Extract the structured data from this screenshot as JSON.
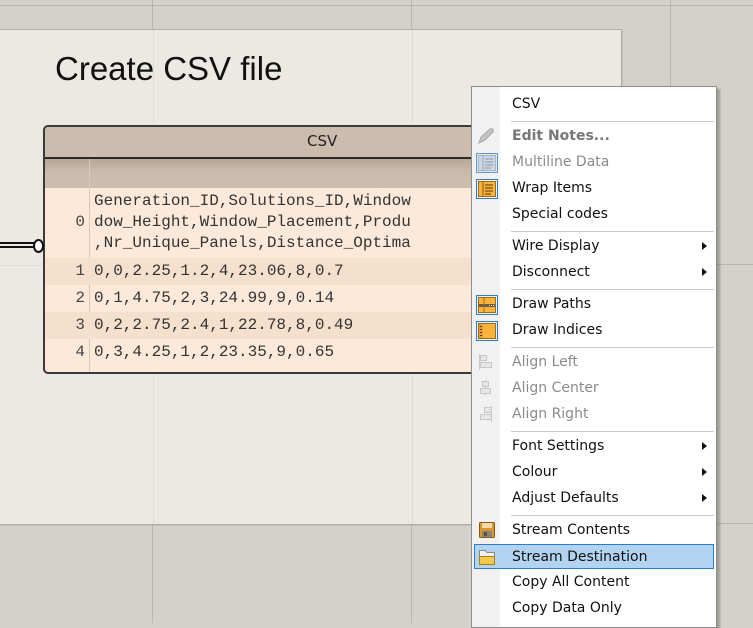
{
  "group": {
    "title": "Create CSV file"
  },
  "panel": {
    "title": "CSV",
    "rows": [
      {
        "index": "0",
        "lines": [
          "Generation_ID,Solutions_ID,Window",
          "dow_Height,Window_Placement,Produ",
          ",Nr_Unique_Panels,Distance_Optima"
        ]
      },
      {
        "index": "1",
        "value": "0,0,2.25,1.2,4,23.06,8,0.7"
      },
      {
        "index": "2",
        "value": "0,1,4.75,2,3,24.99,9,0.14"
      },
      {
        "index": "3",
        "value": "0,2,2.75,2.4,1,22.78,8,0.49"
      },
      {
        "index": "4",
        "value": "0,3,4.25,1,2,23.35,9,0.65"
      }
    ]
  },
  "context_menu": {
    "title": "CSV",
    "items": [
      {
        "label": "Edit Notes...",
        "icon": "pencil-icon",
        "state": "disabled-bold"
      },
      {
        "label": "Multiline Data",
        "icon": "multiline-data-icon",
        "state": "disabled-checked"
      },
      {
        "label": "Wrap Items",
        "icon": "wrap-items-icon",
        "state": "checked"
      },
      {
        "label": "Special codes",
        "icon": null,
        "state": "enabled"
      },
      {
        "label": "Wire Display",
        "icon": null,
        "state": "submenu"
      },
      {
        "label": "Disconnect",
        "icon": null,
        "state": "submenu"
      },
      {
        "label": "Draw Paths",
        "icon": "draw-paths-icon",
        "state": "checked"
      },
      {
        "label": "Draw Indices",
        "icon": "draw-indices-icon",
        "state": "checked"
      },
      {
        "label": "Align Left",
        "icon": "align-left-icon",
        "state": "disabled"
      },
      {
        "label": "Align Center",
        "icon": "align-center-icon",
        "state": "disabled"
      },
      {
        "label": "Align Right",
        "icon": "align-right-icon",
        "state": "disabled"
      },
      {
        "label": "Font Settings",
        "icon": null,
        "state": "submenu"
      },
      {
        "label": "Colour",
        "icon": null,
        "state": "submenu"
      },
      {
        "label": "Adjust Defaults",
        "icon": null,
        "state": "submenu"
      },
      {
        "label": "Stream Contents",
        "icon": "save-disk-icon",
        "state": "enabled"
      },
      {
        "label": "Stream Destination",
        "icon": "folder-icon",
        "state": "highlighted"
      },
      {
        "label": "Copy All Content",
        "icon": null,
        "state": "enabled"
      },
      {
        "label": "Copy Data Only",
        "icon": null,
        "state": "enabled"
      }
    ]
  },
  "colors": {
    "panel_fill": "#fde9d9",
    "panel_header": "#ccbcae",
    "menu_highlight": "#b3d4f1",
    "menu_highlight_border": "#2a7ed1",
    "checked_icon_orange": "#f5a623"
  }
}
